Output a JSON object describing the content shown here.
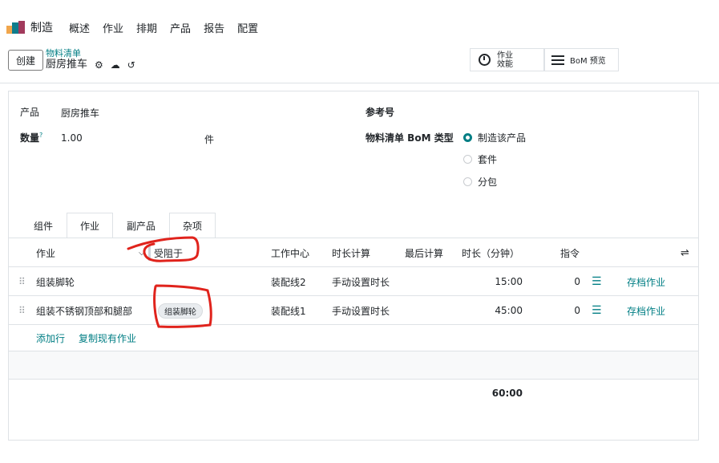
{
  "nav": {
    "app_name": "制造",
    "menu": [
      "概述",
      "作业",
      "排期",
      "产品",
      "报告",
      "配置"
    ]
  },
  "control": {
    "create_label": "创建",
    "breadcrumb_parent": "物料清单",
    "breadcrumb_current": "厨房推车",
    "efficiency_label_line1": "作业",
    "efficiency_label_line2": "效能",
    "bom_preview_label": "BoM 预览"
  },
  "form": {
    "product_label": "产品",
    "product_value": "厨房推车",
    "quantity_label": "数量",
    "quantity_help": "?",
    "quantity_value": "1.00",
    "uom_value": "件",
    "reference_label": "参考号",
    "bom_type_label": "物料清单 BoM 类型",
    "bom_type_options": [
      {
        "label": "制造该产品",
        "selected": true
      },
      {
        "label": "套件",
        "selected": false
      },
      {
        "label": "分包",
        "selected": false
      }
    ]
  },
  "tabs": [
    "组件",
    "作业",
    "副产品",
    "杂项"
  ],
  "active_tab": "作业",
  "table": {
    "headers": {
      "operation": "作业",
      "blocked_by": "受阻于",
      "work_center": "工作中心",
      "duration_computation": "时长计算",
      "last_computation": "最后计算",
      "duration": "时长（分钟）",
      "instructions": "指令"
    },
    "rows": [
      {
        "operation": "组装脚轮",
        "blocked_by": "",
        "work_center": "装配线2",
        "duration_computation": "手动设置时长",
        "duration": "15:00",
        "instructions": "0",
        "archive": "存档作业"
      },
      {
        "operation": "组装不锈钢顶部和腿部",
        "blocked_by": "组装脚轮",
        "work_center": "装配线1",
        "duration_computation": "手动设置时长",
        "duration": "45:00",
        "instructions": "0",
        "archive": "存档作业"
      }
    ],
    "add_line": "添加行",
    "copy_existing": "复制现有作业",
    "total_duration": "60:00"
  },
  "colors": {
    "accent": "#017e84",
    "annotation": "#e0231c"
  }
}
